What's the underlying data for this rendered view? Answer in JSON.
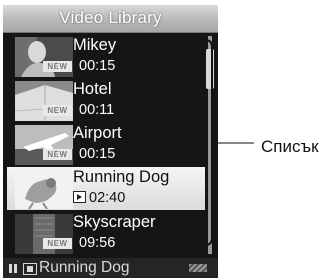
{
  "screen": {
    "title": "Video Library",
    "items": [
      {
        "name": "Mikey",
        "duration": "00:15",
        "badge": "NEW",
        "selected": false,
        "thumbnail_icon": "portrait-thumbnail"
      },
      {
        "name": "Hotel",
        "duration": "00:11",
        "badge": "NEW",
        "selected": false,
        "thumbnail_icon": "building-thumbnail"
      },
      {
        "name": "Airport",
        "duration": "00:15",
        "badge": "NEW",
        "selected": false,
        "thumbnail_icon": "airplane-thumbnail"
      },
      {
        "name": "Running Dog",
        "duration": "02:40",
        "badge": "",
        "selected": true,
        "thumbnail_icon": "dog-thumbnail",
        "status_icon": "play-icon"
      },
      {
        "name": "Skyscraper",
        "duration": "09:56",
        "badge": "NEW",
        "selected": false,
        "thumbnail_icon": "skyscraper-thumbnail"
      }
    ],
    "status_bar": {
      "state_icon": "pause-icon",
      "media_icon": "video-icon",
      "now_playing": "Running Dog",
      "battery_icon": "battery-icon"
    }
  },
  "callout": {
    "label": "Списък"
  },
  "colors": {
    "screen_background": "#151515",
    "selection_background": "#e6e6e6",
    "title_bar": "#c4c4c4",
    "text_light": "#ffffff",
    "text_dark": "#111111"
  }
}
